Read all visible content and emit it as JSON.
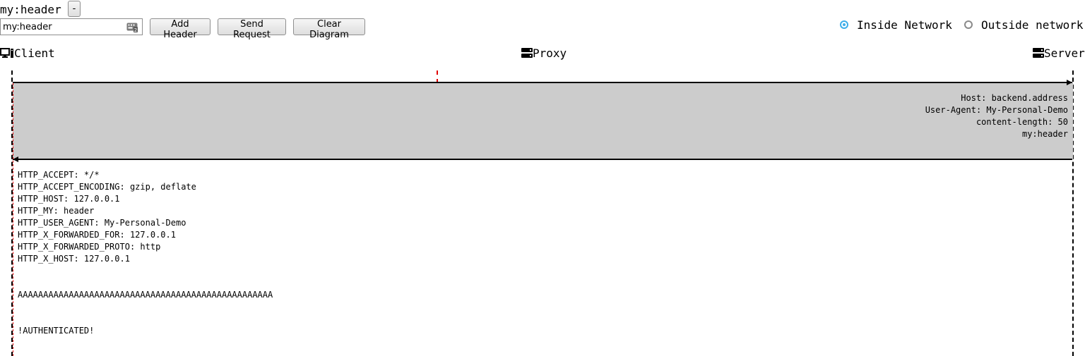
{
  "header_tag": {
    "label": "my:header",
    "remove_label": "-"
  },
  "toolbar": {
    "header_input_value": "my:header",
    "header_input_placeholder": "",
    "add_label": "Add Header",
    "send_label": "Send Request",
    "clear_label": "Clear Diagram"
  },
  "network": {
    "options": [
      {
        "label": "Inside Network",
        "selected": true
      },
      {
        "label": "Outside network",
        "selected": false
      }
    ],
    "accent": "#3daee9"
  },
  "actors": {
    "client": {
      "label": "Client",
      "icon": "desktop-icon"
    },
    "proxy": {
      "label": "Proxy",
      "icon": "server-icon"
    },
    "server": {
      "label": "Server",
      "icon": "server-icon"
    }
  },
  "request": {
    "headers": [
      "Host: backend.address",
      "User-Agent: My-Personal-Demo",
      "content-length: 50",
      "my:header"
    ]
  },
  "response": {
    "headers": [
      "HTTP_ACCEPT: */*",
      "HTTP_ACCEPT_ENCODING: gzip, deflate",
      "HTTP_HOST: 127.0.0.1",
      "HTTP_MY: header",
      "HTTP_USER_AGENT: My-Personal-Demo",
      "HTTP_X_FORWARDED_FOR: 127.0.0.1",
      "HTTP_X_FORWARDED_PROTO: http",
      "HTTP_X_HOST: 127.0.0.1"
    ],
    "filler": "AAAAAAAAAAAAAAAAAAAAAAAAAAAAAAAAAAAAAAAAAAAAAAAAAA",
    "status": "!AUTHENTICATED!"
  },
  "colors": {
    "band": "#cccccc",
    "lifeline_marker": "#e00000"
  }
}
